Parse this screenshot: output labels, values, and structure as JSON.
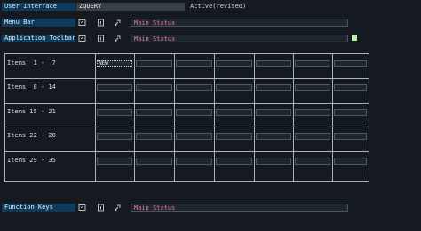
{
  "header": {
    "label": "User Interface",
    "value": "ZQUERY",
    "status": "Active(revised)"
  },
  "rows": [
    {
      "label": "Menu Bar",
      "status": "Main Status",
      "icons": [
        "screen-icon",
        "info-icon",
        "link-icon"
      ]
    },
    {
      "label": "Application Toolbar",
      "status": "Main Status",
      "icons": [
        "screen-icon",
        "info-icon",
        "link-icon"
      ]
    },
    {
      "label": "Function Keys",
      "status": "Main Status",
      "icons": [
        "screen-icon",
        "info-icon",
        "link-icon"
      ]
    }
  ],
  "grid": {
    "rows": [
      {
        "label": "Items  1 -  7"
      },
      {
        "label": "Items  8 - 14"
      },
      {
        "label": "Items 15 - 21"
      },
      {
        "label": "Items 22 - 28"
      },
      {
        "label": "Items 29 - 35"
      }
    ],
    "columns": 7,
    "first_cell_text": "NEW"
  },
  "colors": {
    "label_bg": "#0e3a5c",
    "status_text": "#e07b8c",
    "indicator": "#b4f0a0"
  }
}
